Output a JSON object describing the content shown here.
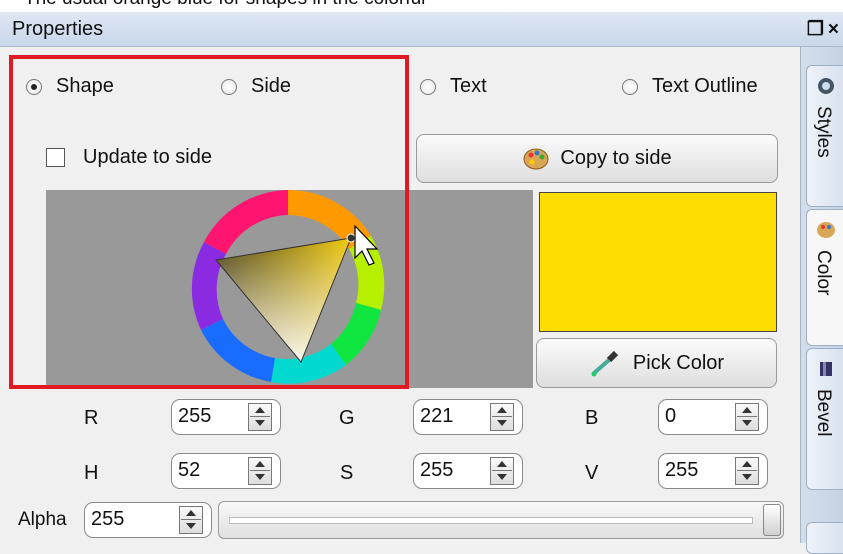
{
  "top_caption": "The usual orange blue for shapes in the colorful",
  "window": {
    "title": "Properties",
    "restore_icon": "restore-icon",
    "close_icon": "close-icon"
  },
  "radios": [
    {
      "label": "Shape",
      "selected": true
    },
    {
      "label": "Side",
      "selected": false
    },
    {
      "label": "Text",
      "selected": false
    },
    {
      "label": "Text Outline",
      "selected": false
    }
  ],
  "update_to_side": {
    "label": "Update to side",
    "checked": false
  },
  "copy_to_side": {
    "label": "Copy to side",
    "icon": "palette-icon"
  },
  "current_color": "#FFDD00",
  "pick_color": {
    "label": "Pick Color",
    "icon": "eyedropper-icon"
  },
  "rgb": {
    "r_label": "R",
    "r": "255",
    "g_label": "G",
    "g": "221",
    "b_label": "B",
    "b": "0"
  },
  "hsv": {
    "h_label": "H",
    "h": "52",
    "s_label": "S",
    "s": "255",
    "v_label": "V",
    "v": "255"
  },
  "alpha": {
    "label": "Alpha",
    "value": "255",
    "fraction": 1.0
  },
  "side_tabs": [
    {
      "label": "Styles",
      "icon": "styles-icon"
    },
    {
      "label": "Color",
      "icon": "palette-icon",
      "active": true
    },
    {
      "label": "Bevel",
      "icon": "bevel-icon"
    }
  ],
  "colors": {
    "highlight": "#E01A22",
    "selected_hue": "#FFDD00"
  }
}
